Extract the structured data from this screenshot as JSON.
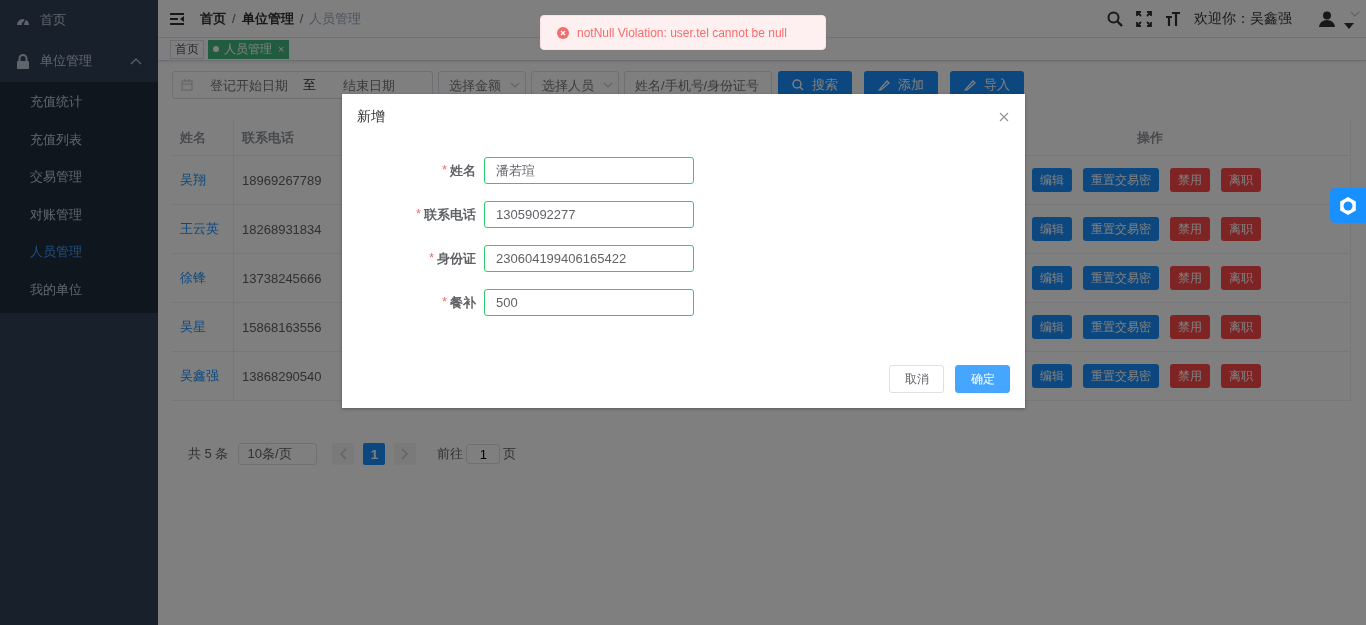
{
  "sidebar": {
    "items": [
      {
        "label": "首页",
        "selected": false
      },
      {
        "label": "单位管理",
        "selected": false,
        "expanded": true,
        "children": [
          {
            "label": "充值统计",
            "selected": false
          },
          {
            "label": "充值列表",
            "selected": false
          },
          {
            "label": "交易管理",
            "selected": false
          },
          {
            "label": "对账管理",
            "selected": false
          },
          {
            "label": "人员管理",
            "selected": true
          },
          {
            "label": "我的单位",
            "selected": false
          }
        ]
      }
    ]
  },
  "header": {
    "breadcrumb": [
      "首页",
      "单位管理",
      "人员管理"
    ],
    "breadcrumb_separator": "/",
    "welcome": "欢迎你：吴鑫强"
  },
  "tags": [
    {
      "label": "首页",
      "selected": false
    },
    {
      "label": "人员管理",
      "selected": true,
      "close": "×"
    }
  ],
  "toast": {
    "kind": "error",
    "message": "notNull Violation: user.tel cannot be null"
  },
  "filters": {
    "date_range": {
      "start_placeholder": "登记开始日期",
      "separator": "至",
      "end_placeholder": "结束日期"
    },
    "selects": [
      {
        "placeholder": "选择金额"
      },
      {
        "placeholder": "选择人员"
      }
    ],
    "search": {
      "placeholder": "姓名/手机号/身份证号"
    },
    "buttons": [
      {
        "label": "搜索",
        "kind": "search"
      },
      {
        "label": "添加",
        "kind": "edit"
      },
      {
        "label": "导入",
        "kind": "edit"
      }
    ]
  },
  "table": {
    "columns": [
      "姓名",
      "联系电话",
      "操作"
    ],
    "rows": [
      {
        "name": "吴翔",
        "phone": "18969267789",
        "actions": [
          {
            "label": "编辑",
            "kind": "primary"
          },
          {
            "label": "重置交易密",
            "kind": "primary"
          },
          {
            "label": "禁用",
            "kind": "danger"
          },
          {
            "label": "离职",
            "kind": "danger"
          }
        ]
      },
      {
        "name": "王云英",
        "phone": "18268931834",
        "actions": [
          {
            "label": "编辑",
            "kind": "primary"
          },
          {
            "label": "重置交易密",
            "kind": "primary"
          },
          {
            "label": "禁用",
            "kind": "danger"
          },
          {
            "label": "离职",
            "kind": "danger"
          }
        ]
      },
      {
        "name": "徐锋",
        "phone": "13738245666",
        "actions": [
          {
            "label": "编辑",
            "kind": "primary"
          },
          {
            "label": "重置交易密",
            "kind": "primary"
          },
          {
            "label": "禁用",
            "kind": "danger"
          },
          {
            "label": "离职",
            "kind": "danger"
          }
        ]
      },
      {
        "name": "吴星",
        "phone": "15868163556",
        "actions": [
          {
            "label": "编辑",
            "kind": "primary"
          },
          {
            "label": "重置交易密",
            "kind": "primary"
          },
          {
            "label": "禁用",
            "kind": "danger"
          },
          {
            "label": "离职",
            "kind": "danger"
          }
        ]
      },
      {
        "name": "吴鑫强",
        "phone": "13868290540",
        "actions": [
          {
            "label": "编辑",
            "kind": "primary"
          },
          {
            "label": "重置交易密",
            "kind": "primary"
          },
          {
            "label": "禁用",
            "kind": "danger"
          },
          {
            "label": "离职",
            "kind": "danger"
          }
        ]
      }
    ]
  },
  "pagination": {
    "total": "共 5 条",
    "page_size": "10条/页",
    "pages": [
      {
        "label": "1",
        "selected": true
      }
    ],
    "goto_label": "前往",
    "goto_value": "1",
    "goto_suffix": "页"
  },
  "dialog": {
    "title": "新增",
    "required_mark": "*",
    "fields": [
      {
        "label": "姓名",
        "required": true,
        "valid": true,
        "value": "潘若瑄"
      },
      {
        "label": "联系电话",
        "required": true,
        "valid": true,
        "value": "13059092277"
      },
      {
        "label": "身份证",
        "required": true,
        "valid": true,
        "value": "230604199406165422"
      },
      {
        "label": "餐补",
        "required": true,
        "valid": true,
        "value": "500"
      }
    ],
    "buttons": [
      {
        "label": "取消",
        "kind": "default"
      },
      {
        "label": "确定",
        "kind": "primary"
      }
    ]
  }
}
